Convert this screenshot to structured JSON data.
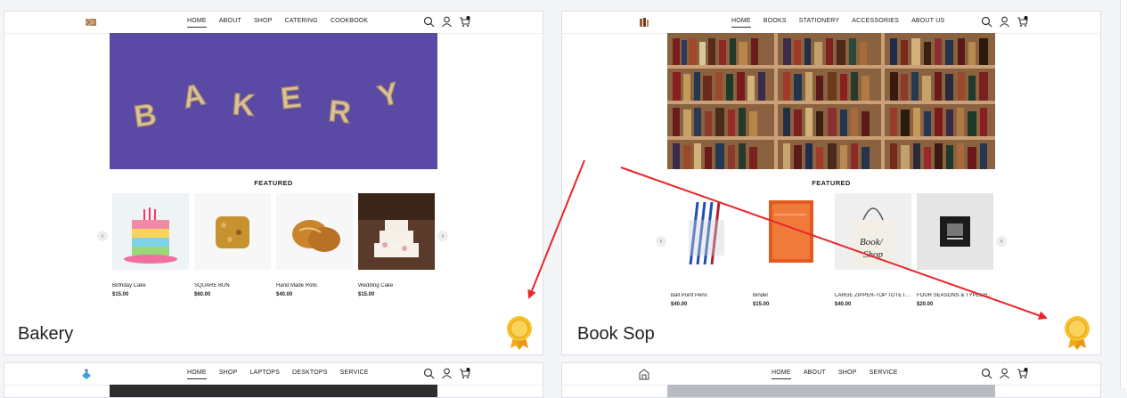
{
  "cards": [
    {
      "title": "Bakery",
      "nav": [
        "HOME",
        "ABOUT",
        "SHOP",
        "CATERING",
        "COOKBOOK"
      ],
      "hero_text": "BAKERY",
      "featured": "FEATURED",
      "products": [
        {
          "name": "Birthday Cake",
          "price": "$15.00"
        },
        {
          "name": "SQUARE BUN",
          "price": "$60.00"
        },
        {
          "name": "Hand Made Rolls",
          "price": "$40.00"
        },
        {
          "name": "Wedding Cake",
          "price": "$15.00"
        }
      ]
    },
    {
      "title": "Book Sop",
      "nav": [
        "HOME",
        "BOOKS",
        "STATIONERY",
        "ACCESSORIES",
        "ABOUT US"
      ],
      "featured": "FEATURED",
      "products": [
        {
          "name": "Ball Point Pens",
          "price": "$40.00"
        },
        {
          "name": "Binder",
          "price": "$15.00"
        },
        {
          "name": "LARGE ZIPPER-TOP TOTE IN...",
          "price": "$40.00"
        },
        {
          "name": "FOUR SEASONS & TYPESH...",
          "price": "$20.00"
        }
      ]
    },
    {
      "nav": [
        "HOME",
        "SHOP",
        "LAPTOPS",
        "DESKTOPS",
        "SERVICE"
      ]
    },
    {
      "nav": [
        "HOME",
        "ABOUT",
        "SHOP",
        "SERVICE"
      ]
    }
  ],
  "colors": {
    "annotation_arrow": "#e8262a",
    "badge_gold": "#f6b81d",
    "bakery_purple": "#5a4aa6"
  },
  "icons": [
    "search-icon",
    "user-icon",
    "cart-icon",
    "award-badge-icon",
    "chevron-left-icon",
    "chevron-right-icon"
  ]
}
